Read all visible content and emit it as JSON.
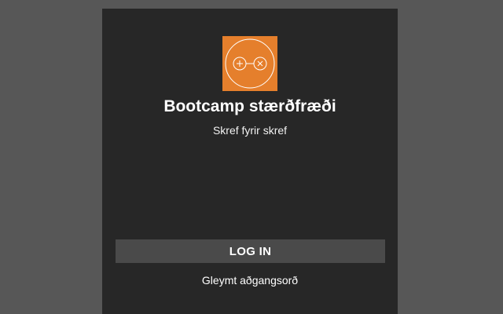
{
  "app": {
    "logo_icon": "plus-minus-times-circle-icon",
    "logo_color": "#e57f2c",
    "title": "Bootcamp stærðfræði",
    "subtitle": "Skref fyrir skref"
  },
  "actions": {
    "login_label": "LOG IN",
    "forgot_password_label": "Gleymt aðgangsorð"
  }
}
